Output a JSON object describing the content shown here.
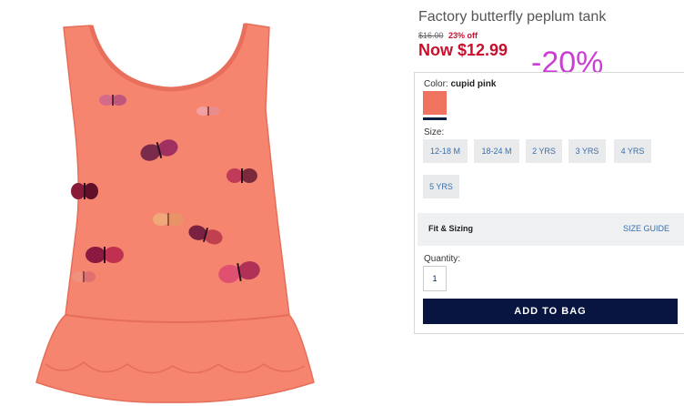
{
  "product": {
    "title": "Factory butterfly peplum tank",
    "original_price": "$16.00",
    "discount_text": "23% off",
    "now_price": "Now $12.99",
    "overlay_discount": "-20%"
  },
  "color": {
    "label": "Color:",
    "value": "cupid pink",
    "swatch_color": "#f07360"
  },
  "size": {
    "label": "Size:",
    "options": [
      "12-18 M",
      "18-24 M",
      "2 YRS",
      "3 YRS",
      "4 YRS",
      "5 YRS"
    ]
  },
  "fit": {
    "label": "Fit & Sizing",
    "guide_link": "SIZE GUIDE"
  },
  "quantity": {
    "label": "Quantity:",
    "value": "1"
  },
  "actions": {
    "add_to_bag": "ADD TO BAG"
  },
  "colors": {
    "sale_red": "#c8102e",
    "navy": "#081540",
    "link_blue": "#3b6fa8",
    "overlay_magenta": "#c93fd6"
  }
}
